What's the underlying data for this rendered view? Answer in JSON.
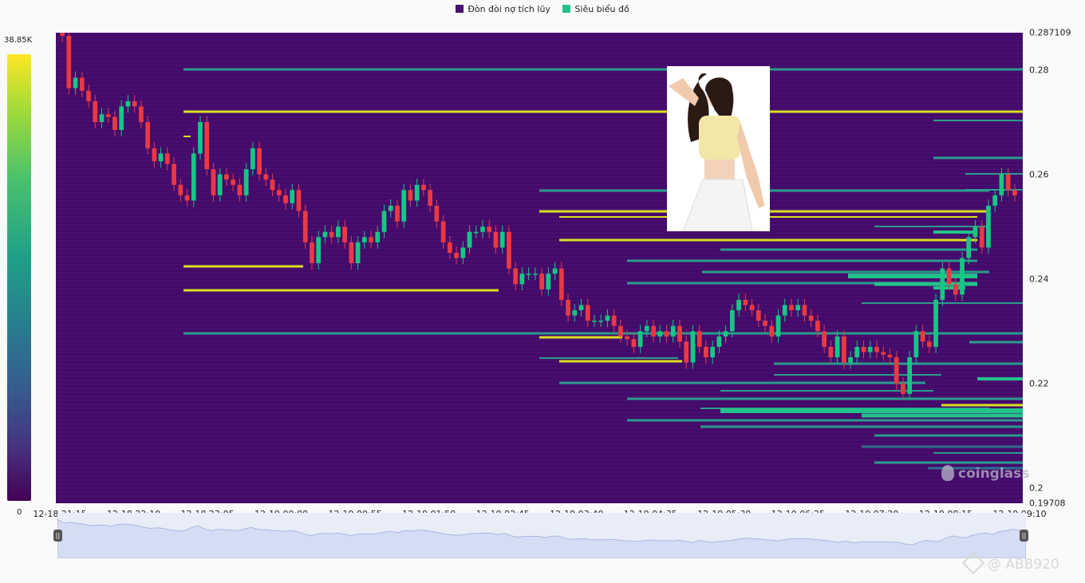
{
  "legend": {
    "items": [
      {
        "label": "Đòn đòi nợ tích lũy",
        "color": "#4a0f6b"
      },
      {
        "label": "Siêu biểu đồ",
        "color": "#22c28a"
      }
    ]
  },
  "colorbar": {
    "max_label": "38.85K",
    "min_label": "0"
  },
  "watermark": {
    "text": "coinglass",
    "icon": "coinglass-logo-icon"
  },
  "credit": {
    "text": "@ ABB920",
    "icon": "binance-square-icon"
  },
  "navigator": {
    "left_handle_icon": "pause-handle-icon",
    "right_handle_icon": "pause-handle-icon"
  },
  "colors": {
    "up": "#16c784",
    "down": "#ea3943",
    "background": "#440a6a",
    "level_yellow": "#d9e021",
    "level_teal": "#2a9c8c",
    "level_green": "#22c28a"
  },
  "chart_data": {
    "type": "candlestick_heatmap",
    "ylim": [
      0.19708,
      0.287109
    ],
    "y_ticks": [
      "0.287109",
      "0.28",
      "0.26",
      "0.24",
      "0.22",
      "0.2",
      "0.19708"
    ],
    "y_tick_values": [
      0.287109,
      0.28,
      0.26,
      0.24,
      0.22,
      0.2,
      0.19708
    ],
    "x_ticks": [
      "12-18 21:15",
      "12-18 22:10",
      "12-18 23:05",
      "12-19 00:00",
      "12-19 00:55",
      "12-19 01:50",
      "12-19 02:45",
      "12-19 03:40",
      "12-19 04:35",
      "12-19 05:30",
      "12-19 06:25",
      "12-19 07:20",
      "12-19 08:15",
      "12-19 09:10"
    ],
    "closes": [
      0.2865,
      0.2765,
      0.2785,
      0.276,
      0.274,
      0.27,
      0.2715,
      0.271,
      0.2685,
      0.273,
      0.274,
      0.273,
      0.27,
      0.265,
      0.2625,
      0.264,
      0.262,
      0.258,
      0.256,
      0.255,
      0.264,
      0.27,
      0.261,
      0.256,
      0.26,
      0.259,
      0.258,
      0.256,
      0.261,
      0.265,
      0.26,
      0.259,
      0.257,
      0.256,
      0.2545,
      0.257,
      0.253,
      0.247,
      0.243,
      0.248,
      0.249,
      0.248,
      0.25,
      0.247,
      0.243,
      0.247,
      0.248,
      0.247,
      0.249,
      0.253,
      0.254,
      0.251,
      0.257,
      0.255,
      0.258,
      0.257,
      0.254,
      0.251,
      0.247,
      0.245,
      0.244,
      0.246,
      0.249,
      0.249,
      0.25,
      0.249,
      0.246,
      0.249,
      0.242,
      0.239,
      0.241,
      0.241,
      0.241,
      0.238,
      0.241,
      0.242,
      0.236,
      0.233,
      0.234,
      0.235,
      0.232,
      0.232,
      0.232,
      0.233,
      0.231,
      0.229,
      0.2285,
      0.227,
      0.23,
      0.231,
      0.229,
      0.23,
      0.229,
      0.231,
      0.228,
      0.224,
      0.23,
      0.227,
      0.225,
      0.227,
      0.229,
      0.23,
      0.234,
      0.236,
      0.235,
      0.234,
      0.232,
      0.231,
      0.229,
      0.233,
      0.235,
      0.234,
      0.235,
      0.233,
      0.232,
      0.23,
      0.227,
      0.225,
      0.229,
      0.224,
      0.225,
      0.227,
      0.226,
      0.227,
      0.226,
      0.2255,
      0.225,
      0.22,
      0.218,
      0.225,
      0.23,
      0.228,
      0.227,
      0.236,
      0.242,
      0.239,
      0.237,
      0.244,
      0.248,
      0.25,
      0.246,
      0.254,
      0.256,
      0.26,
      0.257,
      0.256
    ]
  }
}
